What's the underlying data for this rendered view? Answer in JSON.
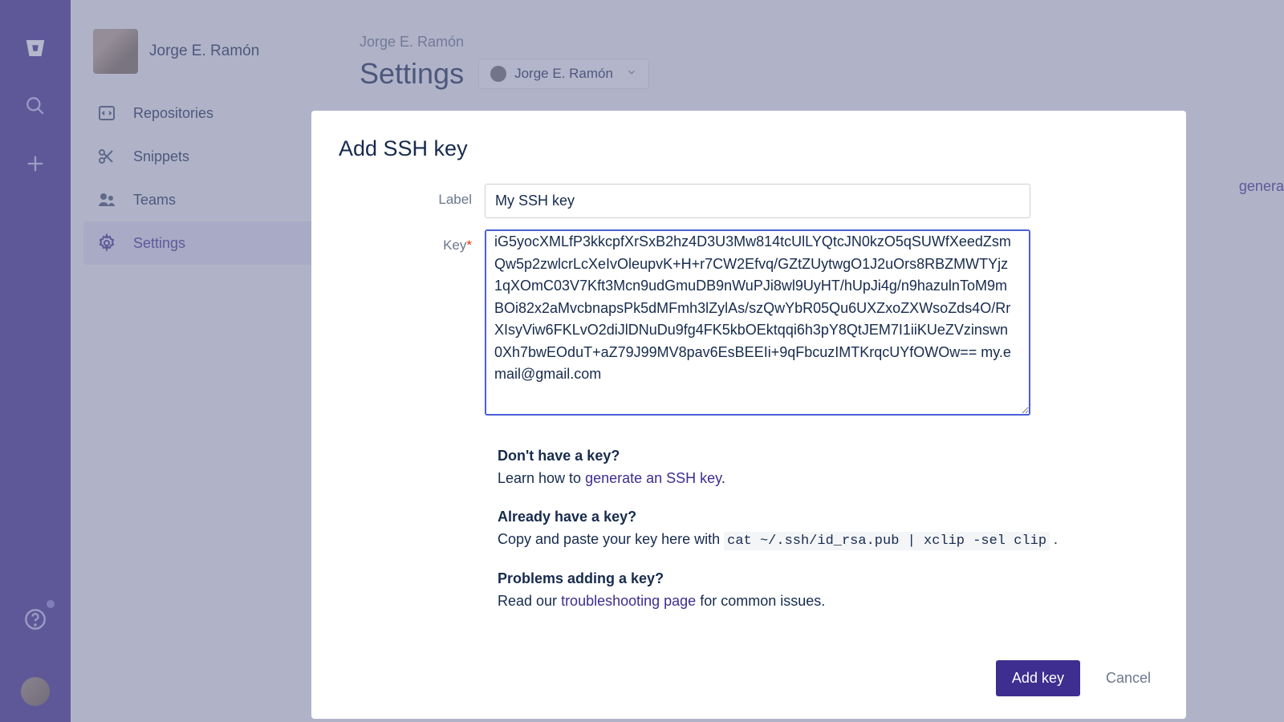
{
  "leftbar": {
    "icons": [
      "bitbucket-icon",
      "search-icon",
      "plus-icon"
    ],
    "bottom_icons": [
      "help-icon",
      "avatar-icon"
    ]
  },
  "sidebar": {
    "profile_name": "Jorge E. Ramón",
    "items": [
      {
        "icon": "code-icon",
        "label": "Repositories"
      },
      {
        "icon": "scissors-icon",
        "label": "Snippets"
      },
      {
        "icon": "people-icon",
        "label": "Teams"
      },
      {
        "icon": "gear-icon",
        "label": "Settings"
      }
    ],
    "active_index": 3
  },
  "header": {
    "breadcrumb": "Jorge E. Ramón",
    "title": "Settings",
    "switcher_name": "Jorge E. Ramón"
  },
  "background": {
    "partial_link_text": "generate an"
  },
  "modal": {
    "title": "Add SSH key",
    "label_field": "Label",
    "label_value": "My SSH key",
    "key_field": "Key",
    "key_value": "iG5yocXMLfP3kkcpfXrSxB2hz4D3U3Mw814tcUlLYQtcJN0kzO5qSUWfXeedZsmQw5p2zwlcrLcXeIvOleupvK+H+r7CW2Efvq/GZtZUytwgO1J2uOrs8RBZMWTYjz1qXOmC03V7Kft3Mcn9udGmuDB9nWuPJi8wl9UyHT/hUpJi4g/n9hazulnToM9mBOi82x2aMvcbnapsPk5dMFmh3lZylAs/szQwYbR05Qu6UXZxoZXWsoZds4O/RrXIsyViw6FKLvO2diJlDNuDu9fg4FK5kbOEktqqi6h3pY8QtJEM7I1iiKUeZVzinswn0Xh7bwEOduT+aZ79J99MV8pav6EsBEEIi+9qFbcuzIMTKrqcUYfOWOw== my.email@gmail.com\n",
    "help": {
      "h1_title": "Don't have a key?",
      "h1_prefix": "Learn how to ",
      "h1_link": "generate an SSH key",
      "h1_suffix": ".",
      "h2_title": "Already have a key?",
      "h2_prefix": "Copy and paste your key here with ",
      "h2_code": "cat ~/.ssh/id_rsa.pub | xclip -sel clip",
      "h2_suffix": " .",
      "h3_title": "Problems adding a key?",
      "h3_prefix": "Read our ",
      "h3_link": "troubleshooting page",
      "h3_suffix": " for common issues."
    },
    "primary_button": "Add key",
    "cancel_button": "Cancel"
  }
}
